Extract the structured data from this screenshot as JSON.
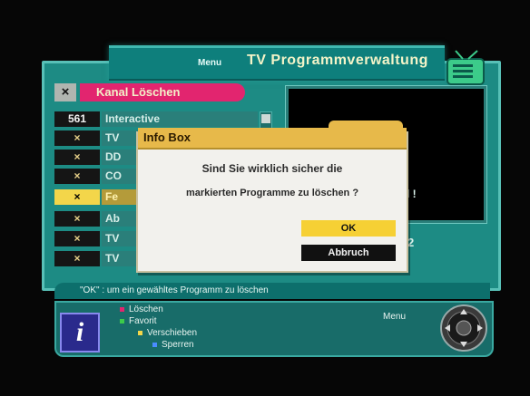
{
  "banner": {
    "menu_label": "Menu",
    "title": "TV Programmverwaltung"
  },
  "channel_list": {
    "title": "Kanal Löschen",
    "rows": [
      {
        "num": "561",
        "name": "Interactive",
        "marked": false,
        "highlighted": false
      },
      {
        "num": "×",
        "name": "TV",
        "marked": true,
        "highlighted": false
      },
      {
        "num": "×",
        "name": "DD",
        "marked": true,
        "highlighted": false
      },
      {
        "num": "×",
        "name": "CO",
        "marked": true,
        "highlighted": false
      },
      {
        "num": "×",
        "name": "Fe",
        "marked": true,
        "highlighted": true
      },
      {
        "num": "×",
        "name": "Ab",
        "marked": true,
        "highlighted": false
      },
      {
        "num": "×",
        "name": "TV",
        "marked": true,
        "highlighted": false
      },
      {
        "num": "×",
        "name": "TV",
        "marked": true,
        "highlighted": false
      }
    ]
  },
  "preview": {
    "fragment": "l !",
    "digit": "2"
  },
  "dialog": {
    "title": "Info Box",
    "message_line1": "Sind Sie wirklich sicher die",
    "message_line2": "markierten Programme zu löschen ?",
    "ok_label": "OK",
    "cancel_label": "Abbruch"
  },
  "footer": {
    "hint": "\"OK\" : um ein gewähltes Programm zu löschen",
    "options": [
      {
        "label": "Löschen",
        "color": "#e2256f"
      },
      {
        "label": "Favorit",
        "color": "#3ccb4a"
      },
      {
        "label": "Verschieben",
        "color": "#f3d64a"
      },
      {
        "label": "Sperren",
        "color": "#4a8cff"
      }
    ],
    "menu_label": "Menu",
    "info_symbol": "i"
  },
  "colors": {
    "panel": "#1d8b84",
    "accent_pink": "#e2256f",
    "dialog_header": "#e7b94a",
    "ok_button": "#f6d034"
  }
}
